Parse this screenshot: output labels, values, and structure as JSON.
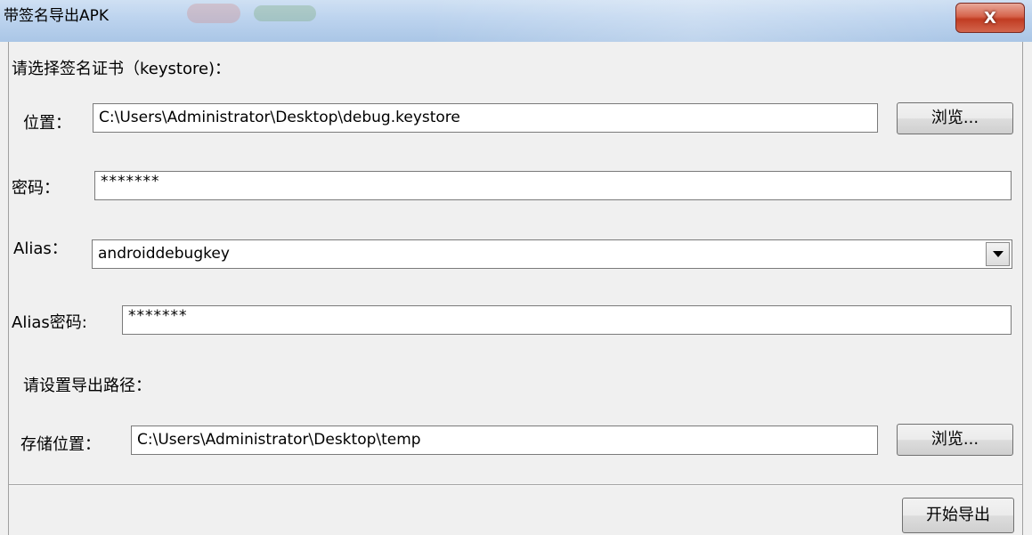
{
  "window": {
    "title": "带签名导出APK",
    "close_label": "X"
  },
  "form": {
    "keystore_heading": "请选择签名证书（keystore)：",
    "location_label": "位置：",
    "location_value": "C:\\Users\\Administrator\\Desktop\\debug.keystore",
    "browse_label": "浏览...",
    "password_label": "密码：",
    "password_value": "*******",
    "alias_label": "Alias：",
    "alias_value": "androiddebugkey",
    "alias_password_label": "Alias密码:",
    "alias_password_value": "*******",
    "export_heading": "请设置导出路径：",
    "storage_label": "存储位置：",
    "storage_value": "C:\\Users\\Administrator\\Desktop\\temp",
    "browse2_label": "浏览...",
    "start_label": "开始导出"
  }
}
